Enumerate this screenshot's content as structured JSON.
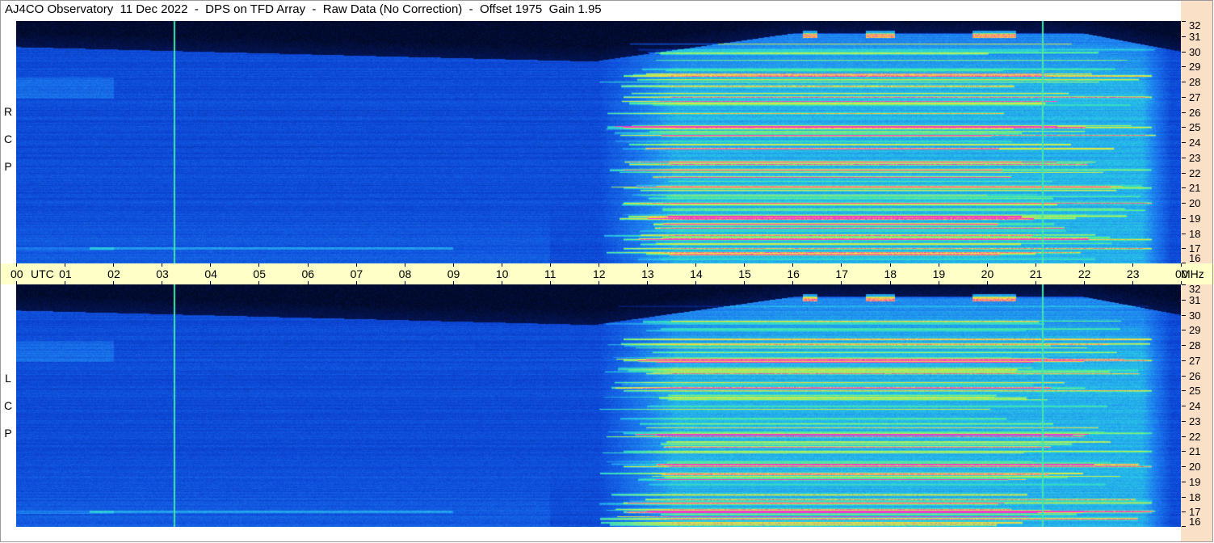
{
  "title": "AJ4CO Observatory  11 Dec 2022  -  DPS on TFD Array  -  Raw Data (No Correction)  -  Offset 1975  Gain 1.95",
  "panels": [
    {
      "id": "rcp",
      "label": "R\nC\nP"
    },
    {
      "id": "lcp",
      "label": "L\nC\nP"
    }
  ],
  "time_axis": {
    "utc_label": "UTC",
    "unit_label": "MHz",
    "labels": [
      "00",
      "01",
      "02",
      "03",
      "04",
      "05",
      "06",
      "07",
      "08",
      "09",
      "10",
      "11",
      "12",
      "13",
      "14",
      "15",
      "16",
      "17",
      "18",
      "19",
      "20",
      "21",
      "22",
      "23",
      "00"
    ]
  },
  "colors": {
    "background_low": "#000820",
    "background_mid": "#0a4ad0",
    "signal_high": "#40e0a0",
    "signal_peak": "#ffe040",
    "axis_panel": "#ffffc8",
    "freq_panel": "#fbe0c8",
    "marker_line": "#c8c890"
  },
  "chart_data": {
    "type": "heatmap",
    "title": "AJ4CO Observatory  11 Dec 2022  -  DPS on TFD Array  -  Raw Data (No Correction)  -  Offset 1975  Gain 1.95",
    "x_axis": {
      "label": "UTC",
      "range": [
        "00",
        "00"
      ],
      "ticks": [
        "00",
        "01",
        "02",
        "03",
        "04",
        "05",
        "06",
        "07",
        "08",
        "09",
        "10",
        "11",
        "12",
        "13",
        "14",
        "15",
        "16",
        "17",
        "18",
        "19",
        "20",
        "21",
        "22",
        "23",
        "00"
      ]
    },
    "y_axis": {
      "label": "MHz",
      "range": [
        16,
        32
      ],
      "ticks": [
        16,
        17,
        18,
        19,
        20,
        21,
        22,
        23,
        24,
        25,
        26,
        27,
        28,
        29,
        30,
        31,
        32
      ]
    },
    "panels": [
      "RCP",
      "LCP"
    ],
    "vertical_markers_utc": [
      3.25,
      21.15
    ],
    "daytime_enhancement_utc": [
      12.0,
      23.8
    ],
    "gain": 1.95,
    "offset": 1975
  }
}
